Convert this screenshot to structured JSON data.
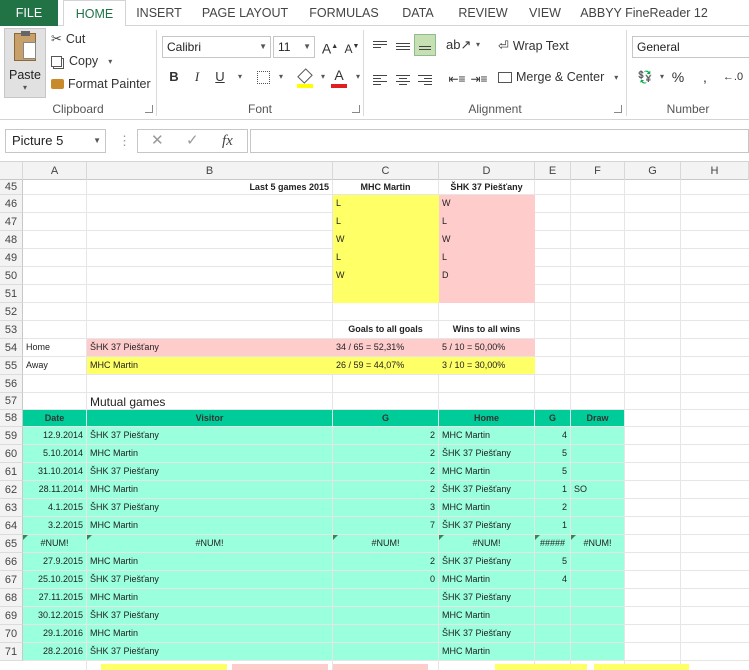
{
  "ribbon": {
    "tabs": [
      "FILE",
      "HOME",
      "INSERT",
      "PAGE LAYOUT",
      "FORMULAS",
      "DATA",
      "REVIEW",
      "VIEW",
      "ABBYY FineReader 12"
    ],
    "clipboard": {
      "paste": "Paste",
      "cut": "Cut",
      "copy": "Copy",
      "format_painter": "Format Painter",
      "label": "Clipboard"
    },
    "font": {
      "name": "Calibri",
      "size": "11",
      "bold": "B",
      "italic": "I",
      "underline": "U",
      "label": "Font",
      "font_color": "#e02020",
      "fill_color": "#ffff00"
    },
    "alignment": {
      "wrap_text": "Wrap Text",
      "merge_center": "Merge & Center",
      "label": "Alignment"
    },
    "number": {
      "format": "General",
      "percent": "%",
      "label": "Number"
    }
  },
  "formula_bar": {
    "name_box": "Picture 5",
    "cancel": "✕",
    "enter": "✓",
    "fx": "fx",
    "formula": ""
  },
  "columns": [
    "A",
    "B",
    "C",
    "D",
    "E",
    "F",
    "G",
    "H"
  ],
  "rows": [
    "45",
    "46",
    "47",
    "48",
    "49",
    "50",
    "51",
    "52",
    "53",
    "54",
    "55",
    "56",
    "57",
    "58",
    "59",
    "60",
    "61",
    "62",
    "63",
    "64",
    "65",
    "66",
    "67",
    "68",
    "69",
    "70",
    "71"
  ],
  "last5": {
    "title": "Last 5 games 2015",
    "team1": "MHC Martin",
    "team2": "ŠHK 37 Piešťany",
    "results1": [
      "L",
      "L",
      "W",
      "L",
      "W"
    ],
    "results2": [
      "W",
      "L",
      "W",
      "L",
      "D"
    ]
  },
  "goals": {
    "goals_header": "Goals to all goals",
    "wins_header": "Wins to all wins",
    "home_label": "Home",
    "away_label": "Away",
    "home_team": "ŠHK 37 Piešťany",
    "away_team": "MHC Martin",
    "home_goals": "34 / 65 = 52,31%",
    "away_goals": "26 / 59 = 44,07%",
    "home_wins": "5 / 10 = 50,00%",
    "away_wins": "3 / 10 = 30,00%"
  },
  "mutual": {
    "title": "Mutual games",
    "headers": [
      "Date",
      "Visitor",
      "G",
      "Home",
      "G",
      "Draw"
    ],
    "rows": [
      [
        "12.9.2014",
        "ŠHK 37 Piešťany",
        "2",
        "MHC Martin",
        "4",
        ""
      ],
      [
        "5.10.2014",
        "MHC Martin",
        "2",
        "ŠHK 37 Piešťany",
        "5",
        ""
      ],
      [
        "31.10.2014",
        "ŠHK 37 Piešťany",
        "2",
        "MHC Martin",
        "5",
        ""
      ],
      [
        "28.11.2014",
        "MHC Martin",
        "2",
        "ŠHK 37 Piešťany",
        "1",
        "SO"
      ],
      [
        "4.1.2015",
        "ŠHK 37 Piešťany",
        "3",
        "MHC Martin",
        "2",
        ""
      ],
      [
        "3.2.2015",
        "MHC Martin",
        "7",
        "ŠHK 37 Piešťany",
        "1",
        ""
      ],
      [
        "#NUM!",
        "#NUM!",
        "#NUM!",
        "#NUM!",
        "#####",
        "#NUM!"
      ],
      [
        "27.9.2015",
        "MHC Martin",
        "2",
        "ŠHK 37 Piešťany",
        "5",
        ""
      ],
      [
        "25.10.2015",
        "ŠHK 37 Piešťany",
        "0",
        "MHC Martin",
        "4",
        ""
      ],
      [
        "27.11.2015",
        "MHC Martin",
        "",
        "ŠHK 37 Piešťany",
        "",
        ""
      ],
      [
        "30.12.2015",
        "ŠHK 37 Piešťany",
        "",
        "MHC Martin",
        "",
        ""
      ],
      [
        "29.1.2016",
        "MHC Martin",
        "",
        "ŠHK 37 Piešťany",
        "",
        ""
      ],
      [
        "28.2.2016",
        "ŠHK 37 Piešťany",
        "",
        "MHC Martin",
        "",
        ""
      ]
    ]
  }
}
